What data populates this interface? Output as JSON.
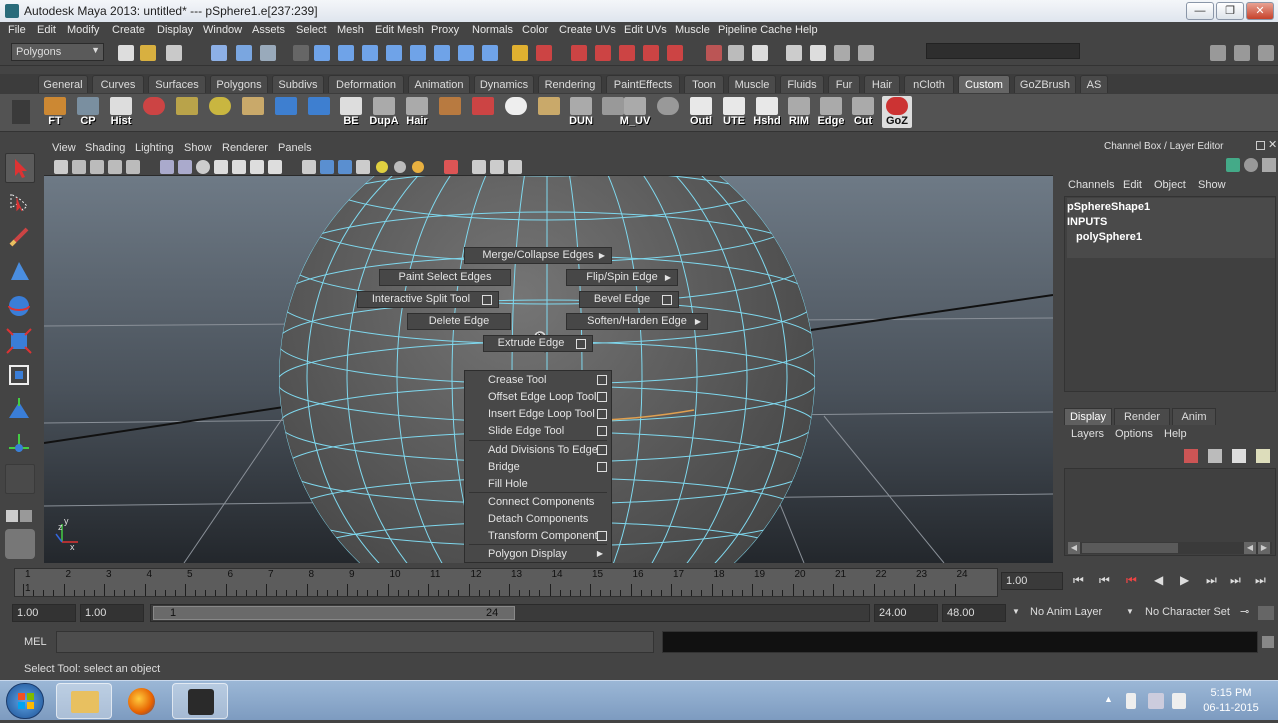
{
  "window": {
    "title": "Autodesk Maya 2013: untitled*   ---   pSphere1.e[237:239]",
    "minimize": "—",
    "restore": "❐",
    "close": "✕"
  },
  "menubar": [
    "File",
    "Edit",
    "Modify",
    "Create",
    "Display",
    "Window",
    "Assets",
    "Select",
    "Mesh",
    "Edit Mesh",
    "Proxy",
    "Normals",
    "Color",
    "Create UVs",
    "Edit UVs",
    "Muscle",
    "Pipeline Cache",
    "Help"
  ],
  "status": {
    "mode": "Polygons"
  },
  "shelf_tabs": [
    "General",
    "Curves",
    "Surfaces",
    "Polygons",
    "Subdivs",
    "Deformation",
    "Animation",
    "Dynamics",
    "Rendering",
    "PaintEffects",
    "Toon",
    "Muscle",
    "Fluids",
    "Fur",
    "Hair",
    "nCloth",
    "Custom",
    "GoZBrush",
    "AS"
  ],
  "active_shelf_tab": "Custom",
  "shelf_buttons": [
    "FT",
    "CP",
    "Hist",
    "",
    "",
    "",
    "",
    "",
    "BE",
    "DupA",
    "Hair",
    "",
    "",
    "",
    "",
    "DUN",
    "M_UV",
    "",
    "Outl",
    "UTE",
    "Hshd",
    "RIM",
    "Edge",
    "Cut",
    "GoZ"
  ],
  "viewport": {
    "menu": [
      "View",
      "Shading",
      "Lighting",
      "Show",
      "Renderer",
      "Panels"
    ]
  },
  "marking_menu": {
    "north": "Merge/Collapse Edges",
    "northwest": "Paint Select Edges",
    "northeast": "Flip/Spin Edge",
    "west": "Interactive Split Tool",
    "east": "Bevel Edge",
    "southwest": "Delete Edge",
    "southeast": "Soften/Harden Edge",
    "south": "Extrude Edge"
  },
  "popup_menu": [
    {
      "label": "Crease Tool",
      "option": true
    },
    {
      "label": "Offset Edge Loop Tool",
      "option": true
    },
    {
      "label": "Insert Edge Loop Tool",
      "option": true
    },
    {
      "label": "Slide Edge Tool",
      "option": true
    },
    {
      "label": "Add Divisions To Edge",
      "option": true
    },
    {
      "label": "Bridge",
      "option": true
    },
    {
      "label": "Fill Hole",
      "option": false
    },
    {
      "label": "Connect Components",
      "option": false
    },
    {
      "label": "Detach Components",
      "option": false
    },
    {
      "label": "Transform Component",
      "option": true
    },
    {
      "label": "Polygon Display",
      "submenu": true
    }
  ],
  "channel_box": {
    "title": "Channel Box / Layer Editor",
    "menu": [
      "Channels",
      "Edit",
      "Object",
      "Show"
    ],
    "object": "pSphereShape1",
    "inputs_label": "INPUTS",
    "input": "polySphere1"
  },
  "layer_editor": {
    "tabs": [
      "Display",
      "Render",
      "Anim"
    ],
    "menu": [
      "Layers",
      "Options",
      "Help"
    ]
  },
  "timeline": {
    "labels": [
      "1",
      "2",
      "3",
      "4",
      "5",
      "6",
      "7",
      "8",
      "9",
      "10",
      "11",
      "12",
      "13",
      "14",
      "15",
      "16",
      "17",
      "18",
      "19",
      "20",
      "21",
      "22",
      "23",
      "24"
    ],
    "current_frame_label": "1",
    "current_time": "1.00"
  },
  "range": {
    "start": "1.00",
    "playback_start": "1.00",
    "slider_start": "1",
    "slider_end": "24",
    "playback_end": "24.00",
    "end": "48.00",
    "anim_layer": "No Anim Layer",
    "character_set": "No Character Set"
  },
  "mel": {
    "label": "MEL"
  },
  "helpline": "Select Tool: select an object",
  "taskbar": {
    "time": "5:15 PM",
    "date": "06-11-2015"
  },
  "colors": {
    "wire": "#7fd8ee",
    "selected_edge": "#e0a050",
    "bg": "#444444"
  }
}
